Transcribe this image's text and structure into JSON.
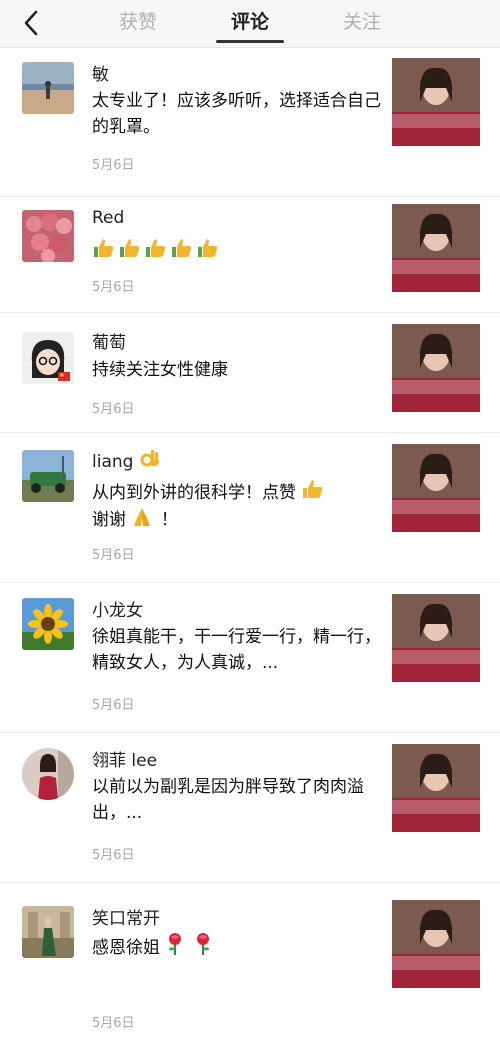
{
  "header": {
    "back_icon": "chevron-left-icon",
    "tabs": [
      {
        "label": "获赞",
        "active": false
      },
      {
        "label": "评论",
        "active": true
      },
      {
        "label": "关注",
        "active": false
      }
    ]
  },
  "comments": [
    {
      "name": "敏",
      "text": "太专业了！应该多听听，选择适合自己的乳罩。",
      "date": "5月6日"
    },
    {
      "name": "Red",
      "text": "",
      "emoji": [
        "thumbs-up-icon",
        "thumbs-up-icon",
        "thumbs-up-icon",
        "thumbs-up-icon",
        "thumbs-up-icon"
      ],
      "date": "5月6日"
    },
    {
      "name": "葡萄",
      "text": "持续关注女性健康",
      "date": "5月6日"
    },
    {
      "name": "liang",
      "name_emoji": "ok-hand-icon",
      "text1": "从内到外讲的很科学！点赞",
      "text2": "谢谢",
      "text2_suffix": "！",
      "date": "5月6日"
    },
    {
      "name": "小龙女",
      "text": "徐姐真能干，干一行爱一行，精一行，精致女人，为人真诚，...",
      "date": "5月6日"
    },
    {
      "name": "翎菲 lee",
      "text": "以前以为副乳是因为胖导致了肉肉溢出，...",
      "date": "5月6日"
    },
    {
      "name": "笑口常开",
      "text": "感恩徐姐",
      "emoji": [
        "rose-icon",
        "rose-icon"
      ],
      "date": "5月6日"
    }
  ],
  "colors": {
    "tab_active": "#222222",
    "tab_inactive": "#b0b0b0",
    "date": "#a8a8a8",
    "divider": "#ececec"
  }
}
